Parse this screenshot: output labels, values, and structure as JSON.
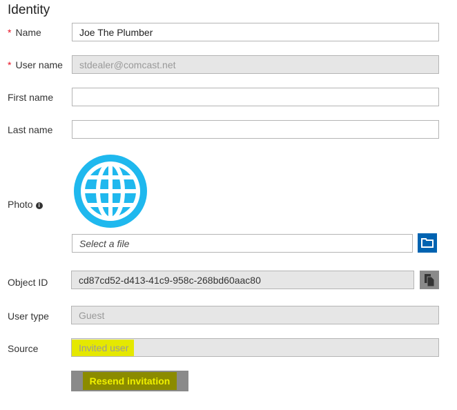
{
  "section_title": "Identity",
  "fields": {
    "name": {
      "label": "Name",
      "value": "Joe The Plumber",
      "required": "*"
    },
    "username": {
      "label": "User name",
      "value": "stdealer@comcast.net",
      "required": "*"
    },
    "first_name": {
      "label": "First name",
      "value": ""
    },
    "last_name": {
      "label": "Last name",
      "value": ""
    },
    "photo": {
      "label": "Photo",
      "info": "i",
      "placeholder": "Select a file"
    },
    "object_id": {
      "label": "Object ID",
      "value": "cd87cd52-d413-41c9-958c-268bd60aac80"
    },
    "user_type": {
      "label": "User type",
      "value": "Guest"
    },
    "source": {
      "label": "Source",
      "value": "Invited user"
    }
  },
  "resend_button": "Resend invitation",
  "colors": {
    "accent": "#0063b1",
    "globe": "#1fb8ee",
    "highlight": "#e5e800"
  }
}
